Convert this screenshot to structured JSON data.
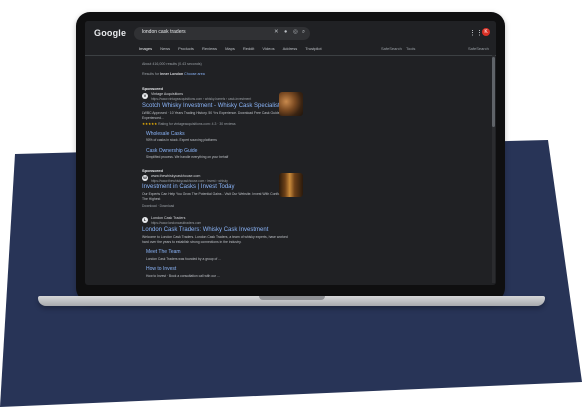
{
  "colors": {
    "navy": "#283457",
    "screen_bg": "#202124",
    "link": "#8ab4f8"
  },
  "header": {
    "logo": "Google",
    "query": "london cask traders",
    "icons": [
      "close-icon",
      "mic-icon",
      "lens-icon",
      "search-icon",
      "apps-icon"
    ],
    "avatar_initial": "K"
  },
  "tabs": [
    "Images",
    "News",
    "Products",
    "Reviews",
    "Maps",
    "Reddit",
    "Videos",
    "Address",
    "Trustpilot"
  ],
  "tools": {
    "settings": "SafeSearch",
    "tools": "Tools",
    "right": "SafeSearch"
  },
  "results_stats": "About 416,000 results (0.43 seconds)",
  "results_for": {
    "prefix": "Results for",
    "place": "Inner London",
    "choose": "Choose area"
  },
  "ads": [
    {
      "sponsored": "Sponsored",
      "site": "Vintage Acquisitions",
      "url": "https://www.vintageacquisitions.com › whisky-barrels › cask-investment",
      "title": "Scotch Whisky Investment - Whisky Cask Specialists",
      "desc": "LWBC Approved · 10 Years Trading History. 50 Yrs Experience. Download Free Cask Guide. Our Experienced...",
      "rating": "Rating for vintageacquisitions.com: 4.3 · 30 reviews",
      "sitelinks": [
        {
          "title": "Wholesale Casks",
          "desc": "90% of casks in stock. Expert sourcing platforms"
        },
        {
          "title": "Cask Ownership Guide",
          "desc": "Simplified process. We handle everything on your behalf"
        }
      ]
    },
    {
      "sponsored": "Sponsored",
      "site": "www.thewhiskycaskhouse.com",
      "url": "https://www.thewhiskycaskhouse.com › invest › whisky",
      "title": "Investment in Casks | Invest Today",
      "desc": "Our Experts Can Help You Grow The Potential Gains - Visit Our Website. Invest With Confidence In The Highest",
      "download": "Download · Download"
    }
  ],
  "organic": {
    "site": "London Cask Traders",
    "url": "https://www.londoncasktraders.com",
    "title": "London Cask Traders: Whisky Cask Investment",
    "desc": "Welcome to London Cask Traders. London Cask Traders, a team of whisky experts, have worked hard over the years to establish strong connections in the industry.",
    "sitelinks": [
      {
        "title": "Meet The Team",
        "desc": "London Cask Traders was founded by a group of ..."
      },
      {
        "title": "How to Invest",
        "desc": "How to Invest · Book a consultation call with our ..."
      }
    ]
  }
}
